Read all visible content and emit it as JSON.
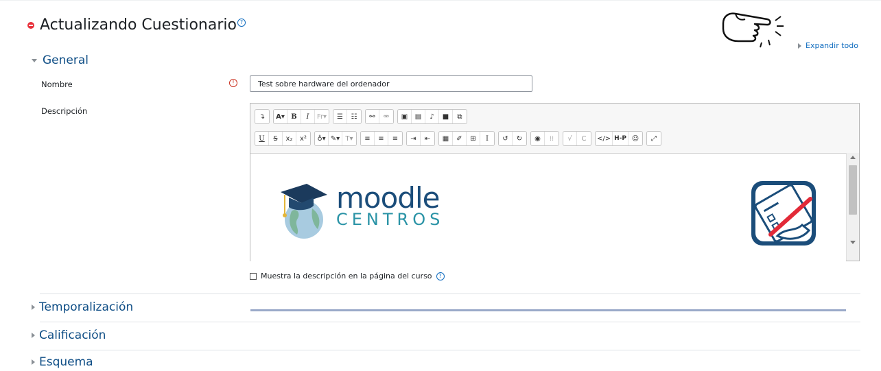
{
  "page": {
    "title": "Actualizando Cuestionario",
    "expand_all": "Expandir todo"
  },
  "general": {
    "header": "General",
    "nombre_label": "Nombre",
    "nombre_value": "Test sobre hardware del ordenador",
    "descripcion_label": "Descripción",
    "editor_toolbar_row1": [
      "↴",
      "A▾",
      "B",
      "I",
      "Fr▾",
      "list",
      "olist",
      "link",
      "unlink",
      "image",
      "media",
      "mic",
      "video",
      "copy"
    ],
    "editor_toolbar_row2": [
      "U",
      "S",
      "x₂",
      "x²",
      "bulb▾",
      "brush▾",
      "T▾",
      "align-left",
      "align-center",
      "align-right",
      "indent",
      "outdent",
      "calc",
      "edit",
      "table",
      "I",
      "undo",
      "redo",
      "a11y",
      "spell",
      "check",
      "C",
      "</>",
      "H-P",
      "☺",
      "fullscreen"
    ],
    "logo_text_1": "moodle",
    "logo_text_2": "CENTROS",
    "show_description": "Muestra la descripción en la página del curso"
  },
  "sections": [
    {
      "label": "Temporalización"
    },
    {
      "label": "Calificación"
    },
    {
      "label": "Esquema"
    }
  ],
  "colors": {
    "accent": "#0f6cbf",
    "section_title": "#0f4e86",
    "required": "#ca3120"
  }
}
